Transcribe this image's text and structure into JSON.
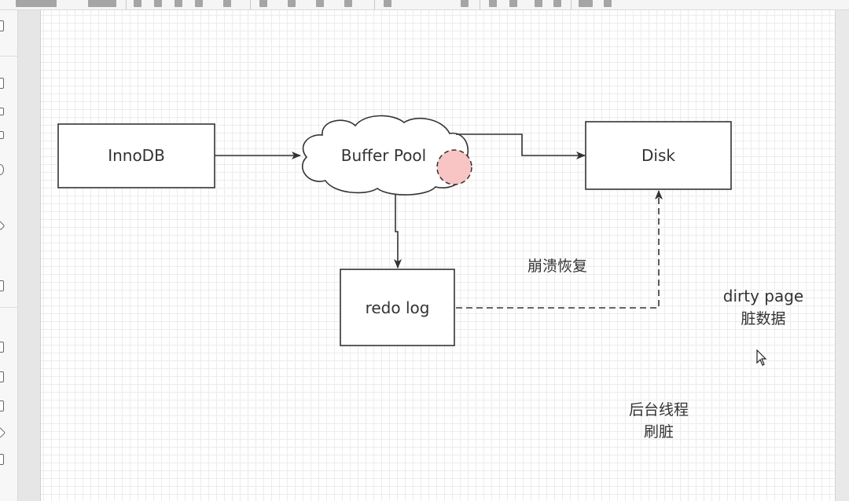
{
  "diagram": {
    "nodes": {
      "innodb": "InnoDB",
      "buffer_pool": "Buffer Pool",
      "disk": "Disk",
      "redo_log": "redo log"
    },
    "annotations": {
      "crash_recovery": "崩溃恢复",
      "dirty_page_en": "dirty page",
      "dirty_page_zh": "脏数据",
      "bg_thread_line1": "后台线程",
      "bg_thread_line2": "刷脏"
    },
    "colors": {
      "stroke": "#333333",
      "dirty_marker_fill": "#f8c4c4",
      "canvas": "#ffffff",
      "grid": "#ececec"
    }
  }
}
